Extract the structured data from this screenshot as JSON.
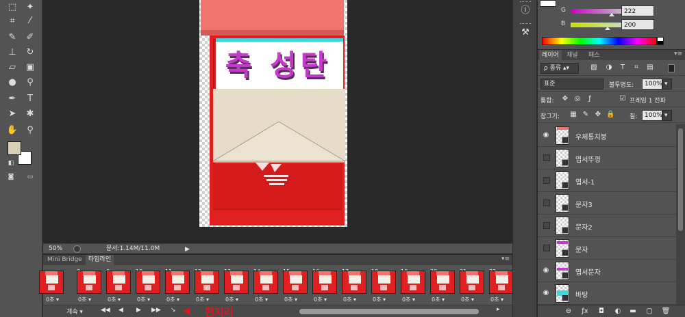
{
  "toolbar": {
    "tools": [
      "marquee-icon",
      "magic-wand-icon",
      "crop-icon",
      "eyedropper-icon",
      "healing-brush-icon",
      "brush-icon",
      "clone-stamp-icon",
      "history-brush-icon",
      "eraser-icon",
      "gradient-icon",
      "blur-icon",
      "dodge-icon",
      "pen-icon",
      "type-icon",
      "path-select-icon",
      "shape-icon",
      "hand-icon",
      "zoom-icon"
    ],
    "type_glyph": "T",
    "foreground_color": "#d9cfb5",
    "background_color": "#ffffff"
  },
  "canvas": {
    "sign_text": "축 성탄"
  },
  "statusbar": {
    "zoom": "50%",
    "doc_info": "문서:1.14M/11.0M"
  },
  "timeline": {
    "tabs": [
      "Mini Bridge",
      "타임라인"
    ],
    "active_tab": "타임라인",
    "frames": [
      {
        "num": "",
        "dur": "0초"
      },
      {
        "num": "8",
        "dur": "0초"
      },
      {
        "num": "9",
        "dur": "0초"
      },
      {
        "num": "10",
        "dur": "0초"
      },
      {
        "num": "11",
        "dur": "0초"
      },
      {
        "num": "12",
        "dur": "0초"
      },
      {
        "num": "13",
        "dur": "0초"
      },
      {
        "num": "14",
        "dur": "0초"
      },
      {
        "num": "15",
        "dur": "0초"
      },
      {
        "num": "16",
        "dur": "0초"
      },
      {
        "num": "17",
        "dur": "0초"
      },
      {
        "num": "18",
        "dur": "0초"
      },
      {
        "num": "19",
        "dur": "0초"
      },
      {
        "num": "20",
        "dur": "0초"
      },
      {
        "num": "21",
        "dur": "0초"
      },
      {
        "num": "22",
        "dur": "0초"
      }
    ],
    "loop_label": "계속",
    "annotation": "편지리"
  },
  "color_panel": {
    "channels": [
      {
        "label": "G",
        "value": "222"
      },
      {
        "label": "B",
        "value": "200"
      }
    ]
  },
  "layers_panel": {
    "tabs": [
      "레이어",
      "채널",
      "패스"
    ],
    "active_tab": "레이어",
    "filter_label": "ρ 종류",
    "blend_mode": "표준",
    "opacity_label": "불투명도:",
    "opacity_value": "100%",
    "unify_label": "통합:",
    "propagate_label": "프레임 1 전파",
    "lock_label": "잠그기:",
    "fill_label": "칠:",
    "fill_value": "100%",
    "layers": [
      {
        "name": "우체통지붕",
        "visible": true
      },
      {
        "name": "엽서뚜껑",
        "visible": false
      },
      {
        "name": "엽서-1",
        "visible": false
      },
      {
        "name": "문자3",
        "visible": false
      },
      {
        "name": "문자2",
        "visible": false
      },
      {
        "name": "문자",
        "visible": false
      },
      {
        "name": "엽서문자",
        "visible": true
      },
      {
        "name": "바탕",
        "visible": true
      }
    ]
  }
}
